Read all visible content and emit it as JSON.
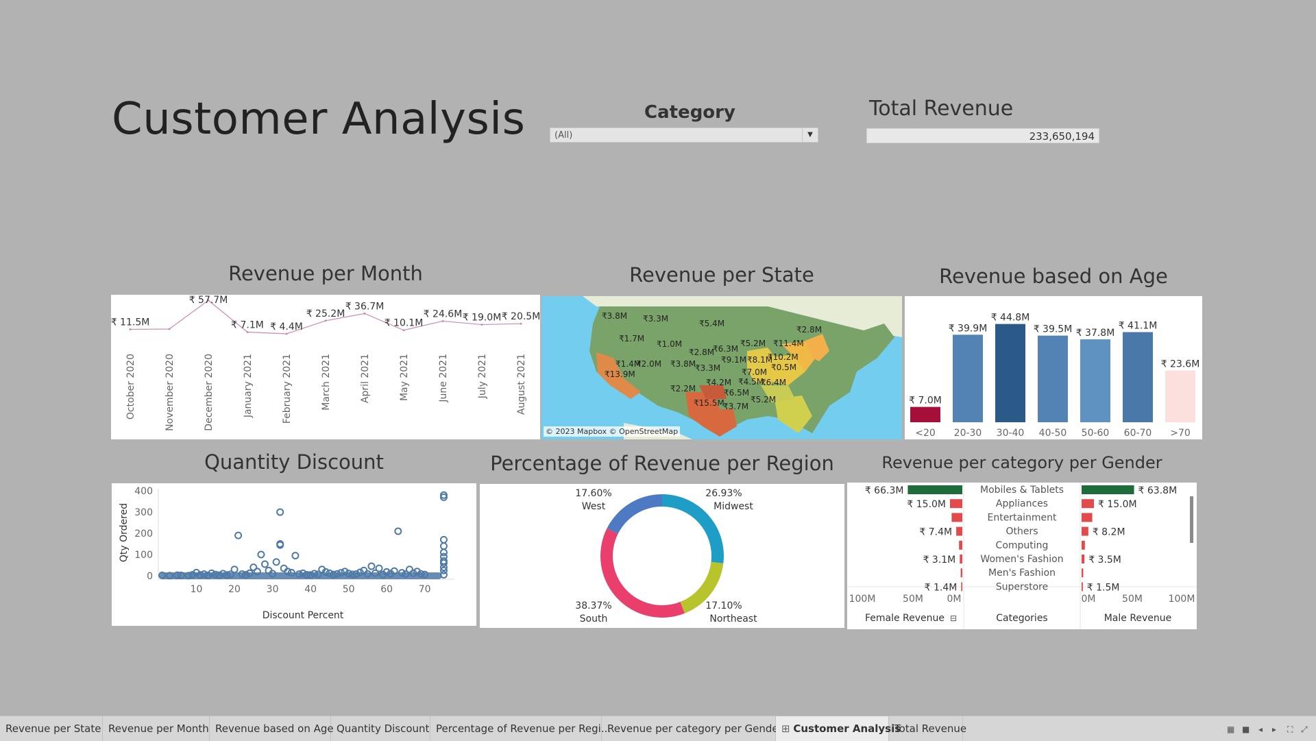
{
  "dashboard": {
    "title": "Customer Analysis",
    "filter_label": "Category",
    "filter_value": "(All)",
    "kpi_label": "Total Revenue",
    "kpi_value": "233,650,194"
  },
  "sheets": {
    "month_title": "Revenue per Month",
    "state_title": "Revenue per State",
    "age_title": "Revenue based on Age",
    "discount_title": "Quantity Discount",
    "region_title": "Percentage of Revenue per Region",
    "gender_title": "Revenue per category per Gender"
  },
  "map": {
    "attribution": "© 2023 Mapbox © OpenStreetMap",
    "labels": [
      "₹3.8M",
      "₹3.3M",
      "₹5.4M",
      "₹1.7M",
      "₹1.0M",
      "₹2.8M",
      "₹6.3M",
      "₹5.2M",
      "₹11.4M",
      "₹2.8M",
      "₹1.4M",
      "₹2.0M",
      "₹3.8M",
      "₹3.3M",
      "₹9.1M",
      "₹8.1M",
      "₹10.2M",
      "₹0.5M",
      "₹7.0M",
      "₹13.9M",
      "₹2.2M",
      "₹4.2M",
      "₹4.5M",
      "₹6.4M",
      "₹6.5M",
      "₹15.5M",
      "₹3.7M",
      "₹5.2M"
    ]
  },
  "chart_data": [
    {
      "type": "line",
      "title": "Revenue per Month",
      "categories": [
        "October 2020",
        "November 2020",
        "December 2020",
        "January 2021",
        "February 2021",
        "March 2021",
        "April 2021",
        "May 2021",
        "June 2021",
        "July 2021",
        "August 2021"
      ],
      "values": [
        11.5,
        12.0,
        57.7,
        7.1,
        4.4,
        25.2,
        36.7,
        10.1,
        24.6,
        19.0,
        20.5
      ],
      "labels": [
        "₹ 11.5M",
        "",
        "₹ 57.7M",
        "₹ 7.1M",
        "₹ 4.4M",
        "₹ 25.2M",
        "₹ 36.7M",
        "₹ 10.1M",
        "₹ 24.6M",
        "₹ 19.0M",
        "₹ 20.5M"
      ],
      "color": "#c98bb3"
    },
    {
      "type": "bar",
      "title": "Revenue based on Age",
      "categories": [
        "<20",
        "20-30",
        "30-40",
        "40-50",
        "50-60",
        "60-70",
        ">70"
      ],
      "values": [
        7.0,
        39.9,
        44.8,
        39.5,
        37.8,
        41.1,
        23.6
      ],
      "labels": [
        "₹ 7.0M",
        "₹ 39.9M",
        "₹ 44.8M",
        "₹ 39.5M",
        "₹ 37.8M",
        "₹ 41.1M",
        "₹ 23.6M"
      ],
      "colors": [
        "#a50f3a",
        "#5382b4",
        "#2c5a88",
        "#5382b4",
        "#5f92c0",
        "#4a78a8",
        "#fbe0de"
      ]
    },
    {
      "type": "scatter",
      "title": "Quantity Discount",
      "xlabel": "Discount Percent",
      "ylabel": "Qty Ordered",
      "xticks": [
        "10",
        "20",
        "30",
        "40",
        "50",
        "60",
        "70"
      ],
      "yticks": [
        "0",
        "100",
        "200",
        "300",
        "400"
      ],
      "xlim": [
        0,
        76
      ],
      "ylim": [
        0,
        410
      ],
      "points": [
        [
          1,
          2
        ],
        [
          3,
          1
        ],
        [
          5,
          3
        ],
        [
          6,
          2
        ],
        [
          8,
          1
        ],
        [
          9,
          5
        ],
        [
          10,
          15
        ],
        [
          11,
          4
        ],
        [
          12,
          8
        ],
        [
          13,
          2
        ],
        [
          14,
          12
        ],
        [
          15,
          6
        ],
        [
          16,
          3
        ],
        [
          17,
          10
        ],
        [
          18,
          4
        ],
        [
          19,
          7
        ],
        [
          20,
          30
        ],
        [
          21,
          190
        ],
        [
          22,
          8
        ],
        [
          23,
          5
        ],
        [
          24,
          12
        ],
        [
          25,
          40
        ],
        [
          26,
          20
        ],
        [
          27,
          100
        ],
        [
          28,
          55
        ],
        [
          29,
          25
        ],
        [
          30,
          10
        ],
        [
          31,
          65
        ],
        [
          32,
          150
        ],
        [
          32,
          145
        ],
        [
          32,
          300
        ],
        [
          33,
          35
        ],
        [
          34,
          20
        ],
        [
          35,
          15
        ],
        [
          36,
          95
        ],
        [
          37,
          8
        ],
        [
          38,
          12
        ],
        [
          39,
          5
        ],
        [
          40,
          4
        ],
        [
          41,
          10
        ],
        [
          42,
          7
        ],
        [
          43,
          30
        ],
        [
          44,
          18
        ],
        [
          45,
          12
        ],
        [
          46,
          6
        ],
        [
          47,
          9
        ],
        [
          48,
          14
        ],
        [
          49,
          20
        ],
        [
          50,
          11
        ],
        [
          51,
          7
        ],
        [
          52,
          8
        ],
        [
          53,
          16
        ],
        [
          54,
          25
        ],
        [
          55,
          9
        ],
        [
          56,
          45
        ],
        [
          57,
          12
        ],
        [
          58,
          35
        ],
        [
          59,
          6
        ],
        [
          60,
          18
        ],
        [
          61,
          10
        ],
        [
          62,
          22
        ],
        [
          63,
          210
        ],
        [
          64,
          14
        ],
        [
          65,
          8
        ],
        [
          66,
          30
        ],
        [
          67,
          12
        ],
        [
          68,
          20
        ],
        [
          69,
          9
        ],
        [
          70,
          6
        ],
        [
          75,
          5
        ],
        [
          75,
          25
        ],
        [
          75,
          40
        ],
        [
          75,
          60
        ],
        [
          75,
          70
        ],
        [
          75,
          90
        ],
        [
          75,
          110
        ],
        [
          75,
          140
        ],
        [
          75,
          170
        ],
        [
          75,
          380
        ],
        [
          75,
          370
        ]
      ],
      "color": "#4e79a7"
    },
    {
      "type": "pie",
      "title": "Percentage of Revenue per Region",
      "categories": [
        "Midwest",
        "Northeast",
        "South",
        "West"
      ],
      "values": [
        26.93,
        17.1,
        38.37,
        17.6
      ],
      "labels": [
        "26.93%",
        "17.10%",
        "38.37%",
        "17.60%"
      ],
      "colors": [
        "#1e9ec6",
        "#b8c42c",
        "#ea3e6c",
        "#4e79c3"
      ]
    },
    {
      "type": "bar",
      "title": "Revenue per category per Gender",
      "categories": [
        "Mobiles & Tablets",
        "Appliances",
        "Entertainment",
        "Others",
        "Computing",
        "Women's Fashion",
        "Men's Fashion",
        "Superstore"
      ],
      "series": [
        {
          "name": "Female Revenue",
          "values": [
            66.3,
            15.0,
            13.0,
            7.4,
            4.0,
            3.1,
            2.0,
            1.4
          ],
          "labels": [
            "₹ 66.3M",
            "₹ 15.0M",
            "",
            "₹ 7.4M",
            "",
            "₹ 3.1M",
            "",
            "₹ 1.4M"
          ]
        },
        {
          "name": "Male Revenue",
          "values": [
            63.8,
            15.0,
            13.0,
            8.2,
            4.0,
            3.5,
            2.0,
            1.5
          ],
          "labels": [
            "₹ 63.8M",
            "₹ 15.0M",
            "",
            "₹ 8.2M",
            "",
            "₹ 3.5M",
            "",
            "₹ 1.5M"
          ]
        }
      ],
      "axis_ticks_female": [
        "100M",
        "50M",
        "0M"
      ],
      "axis_ticks_male": [
        "0M",
        "50M",
        "100M"
      ],
      "center_header": "Categories",
      "colors": [
        "#1e6b3c",
        "#e24b4b"
      ]
    }
  ],
  "tabs": [
    {
      "label": "Revenue per State",
      "active": false
    },
    {
      "label": "Revenue per Month",
      "active": false
    },
    {
      "label": "Revenue based on Age",
      "active": false
    },
    {
      "label": "Quantity Discount",
      "active": false
    },
    {
      "label": "Percentage of Revenue per Regi...",
      "active": false
    },
    {
      "label": "Revenue per category per Gender",
      "active": false
    },
    {
      "label": "Customer Analysis",
      "active": true
    },
    {
      "label": "Total Revenue",
      "active": false
    }
  ]
}
